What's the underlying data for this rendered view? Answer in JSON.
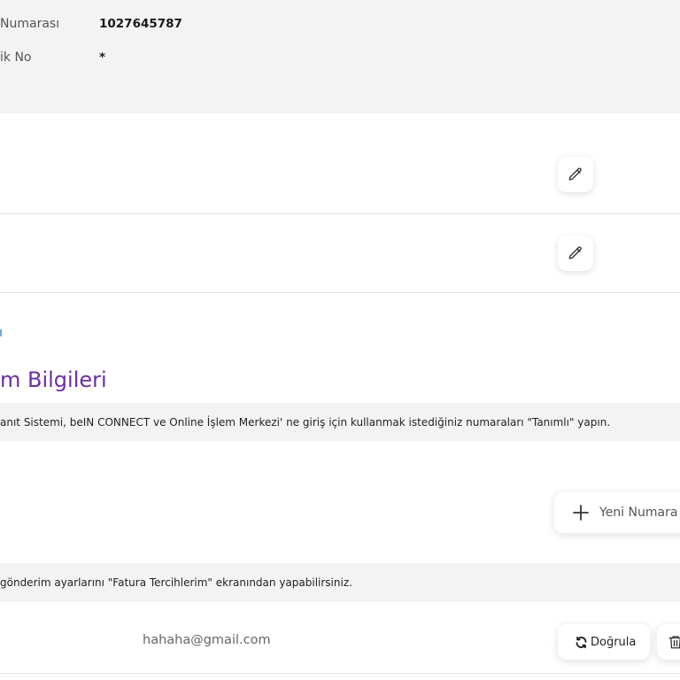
{
  "account": {
    "customer_number_label": "Numarası",
    "customer_number_value": "1027645787",
    "id_label": "ik No",
    "id_value": "*"
  },
  "contact": {
    "title": "m Bilgileri",
    "description": "anıt Sistemi, beIN CONNECT ve Online İşlem Merkezi' ne giriş için kullanmak istediğiniz numaraları \"Tanımlı\" yapın.",
    "new_number_label": "Yeni Numara",
    "invoice_note": "gönderim ayarlarını \"Fatura Tercihlerim\" ekranından yapabilirsiniz.",
    "email_value": "hahaha@gmail.com",
    "verify_label": "Doğrula"
  }
}
